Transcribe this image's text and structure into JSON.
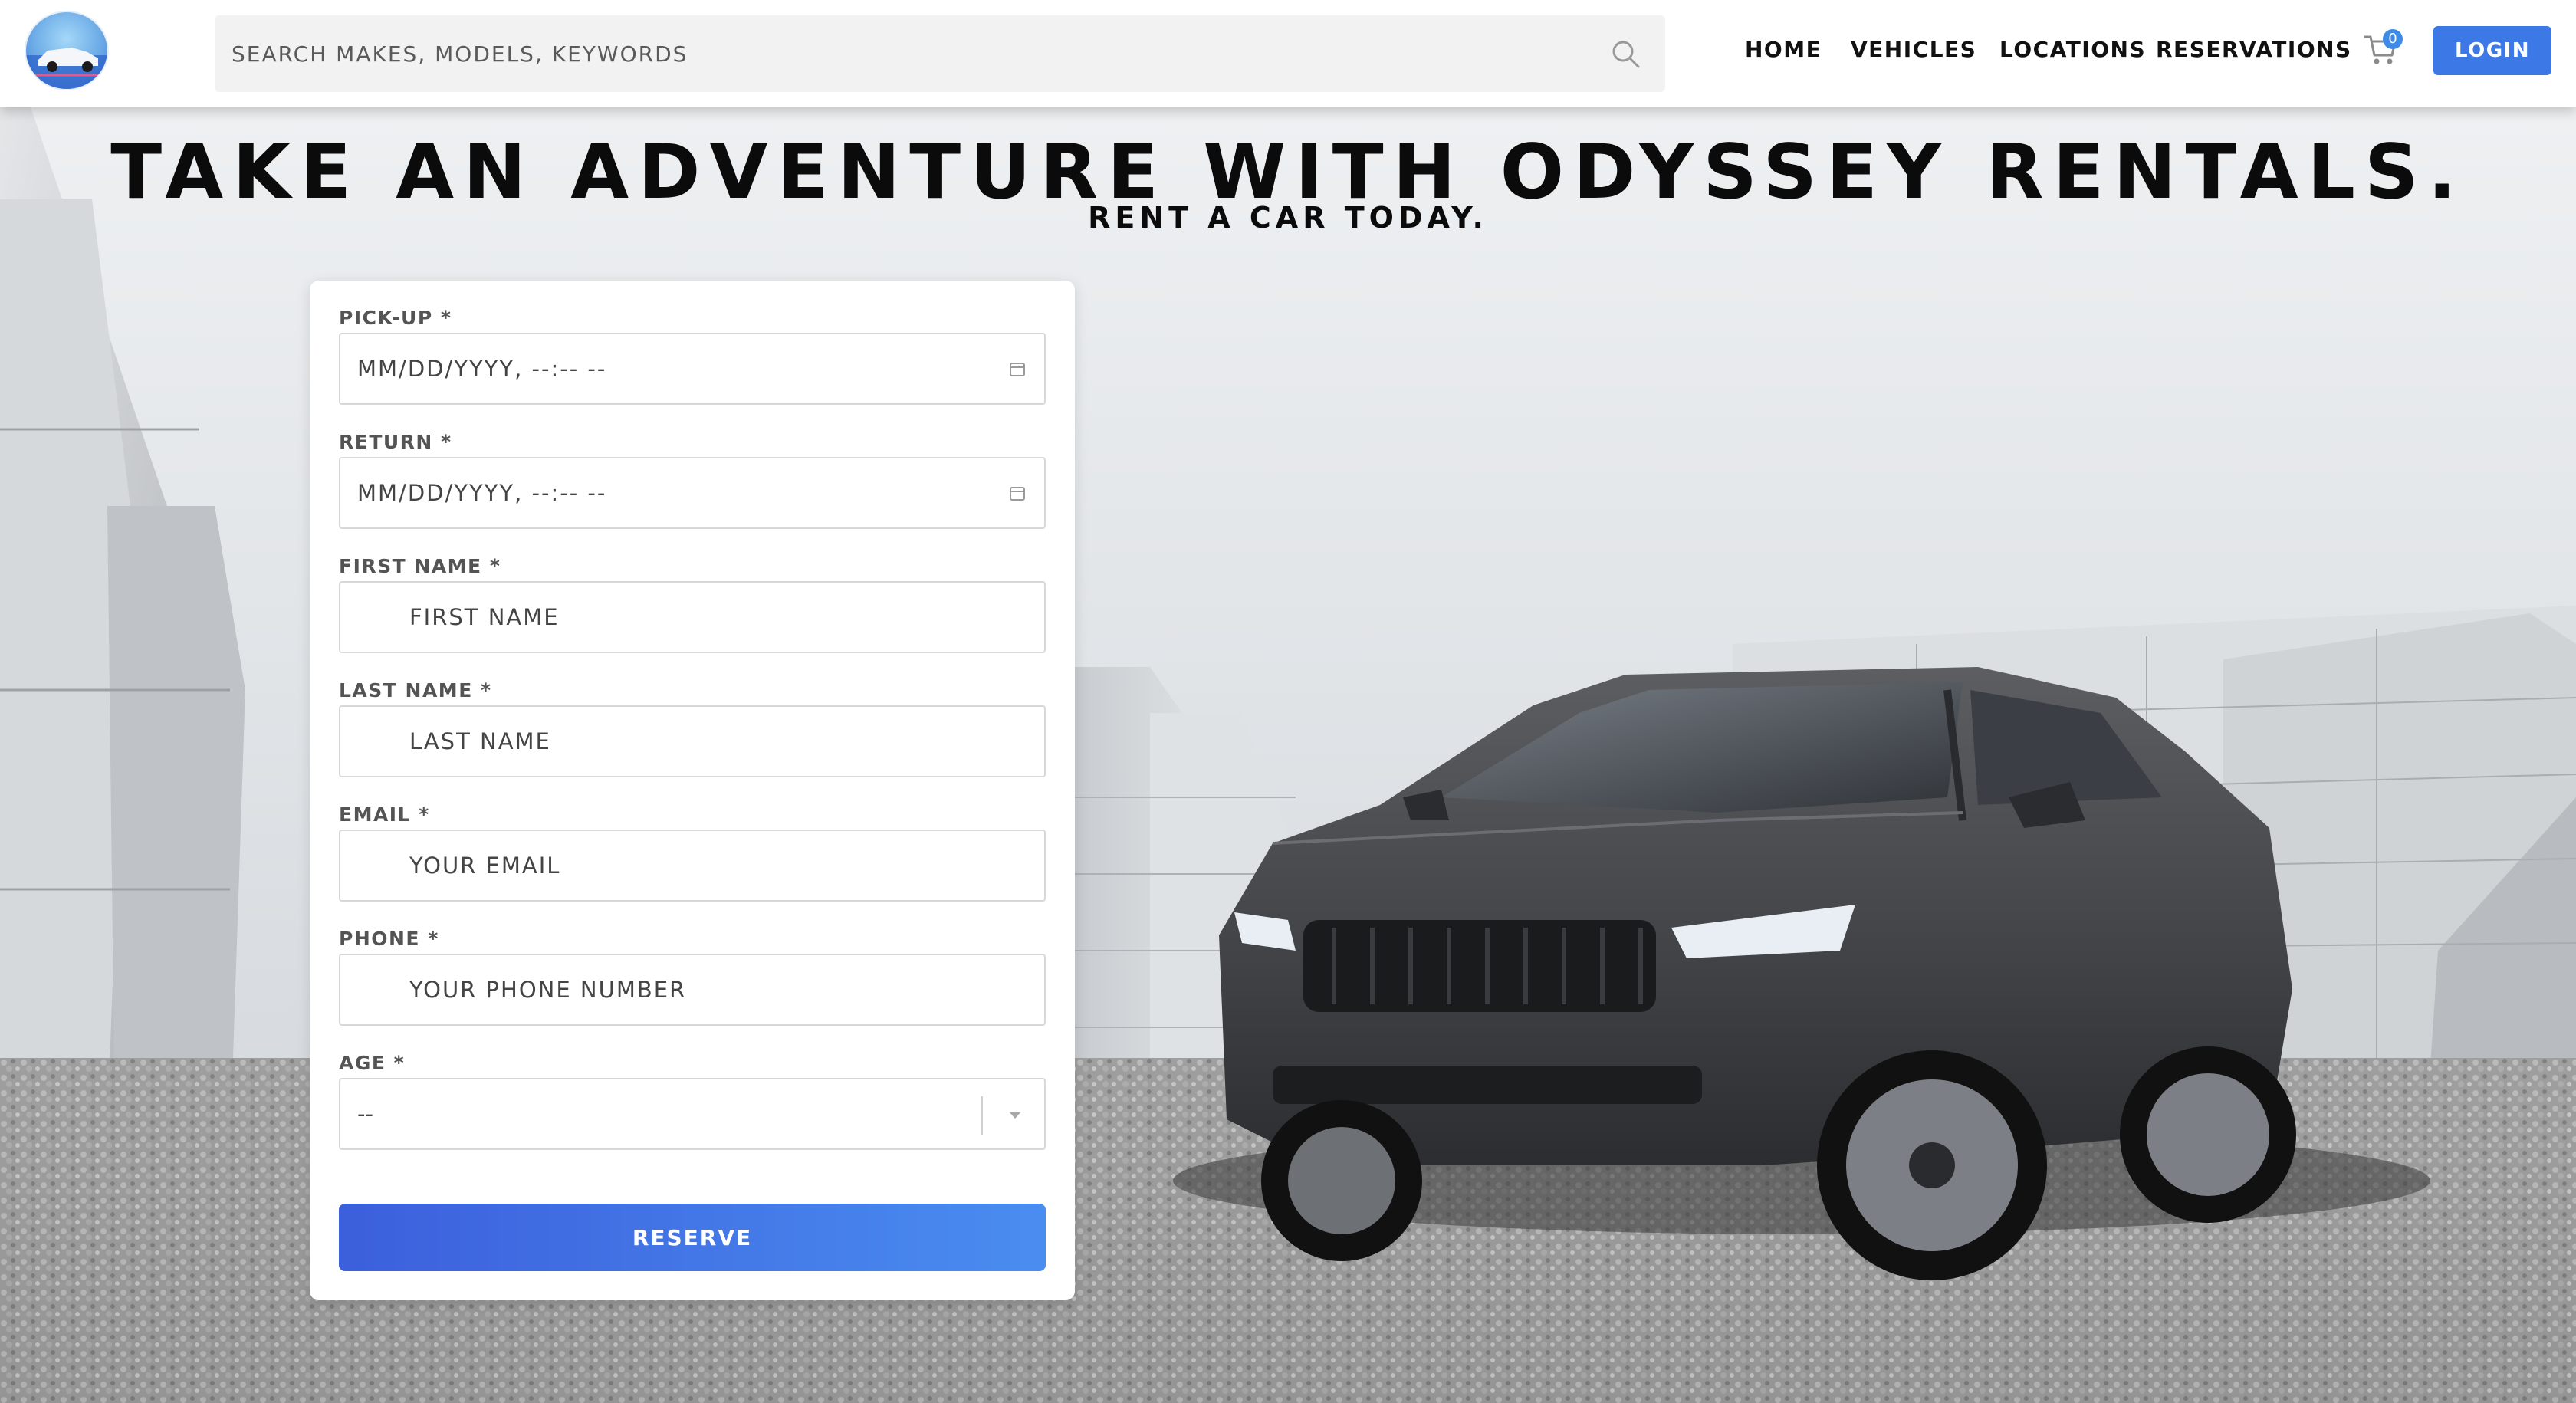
{
  "header": {
    "search_placeholder": "Search makes, models, keywords",
    "nav": {
      "home": "Home",
      "vehicles": "Vehicles",
      "locations": "Locations",
      "reservations": "Reservations"
    },
    "cart_count": "0",
    "login_label": "Login"
  },
  "hero": {
    "title": "Take an adventure with Odyssey Rentals.",
    "subtitle": "Rent a car today."
  },
  "form": {
    "pickup": {
      "label": "Pick-up *",
      "placeholder": "mm/dd/yyyy, --:-- --"
    },
    "return": {
      "label": "Return *",
      "placeholder": "mm/dd/yyyy, --:-- --"
    },
    "first_name": {
      "label": "First Name *",
      "placeholder": "First Name"
    },
    "last_name": {
      "label": "Last Name *",
      "placeholder": "Last Name"
    },
    "email": {
      "label": "Email *",
      "placeholder": "Your Email"
    },
    "phone": {
      "label": "Phone *",
      "placeholder": "Your Phone Number"
    },
    "age": {
      "label": "Age *",
      "value": "--"
    },
    "submit_label": "Reserve"
  },
  "colors": {
    "accent": "#3c78e6",
    "button_gradient_start": "#3c5fdc",
    "button_gradient_end": "#4a8df0"
  },
  "icons": {
    "search": "search-icon",
    "cart": "cart-icon",
    "calendar": "calendar-icon",
    "dropdown": "chevron-down-icon"
  }
}
